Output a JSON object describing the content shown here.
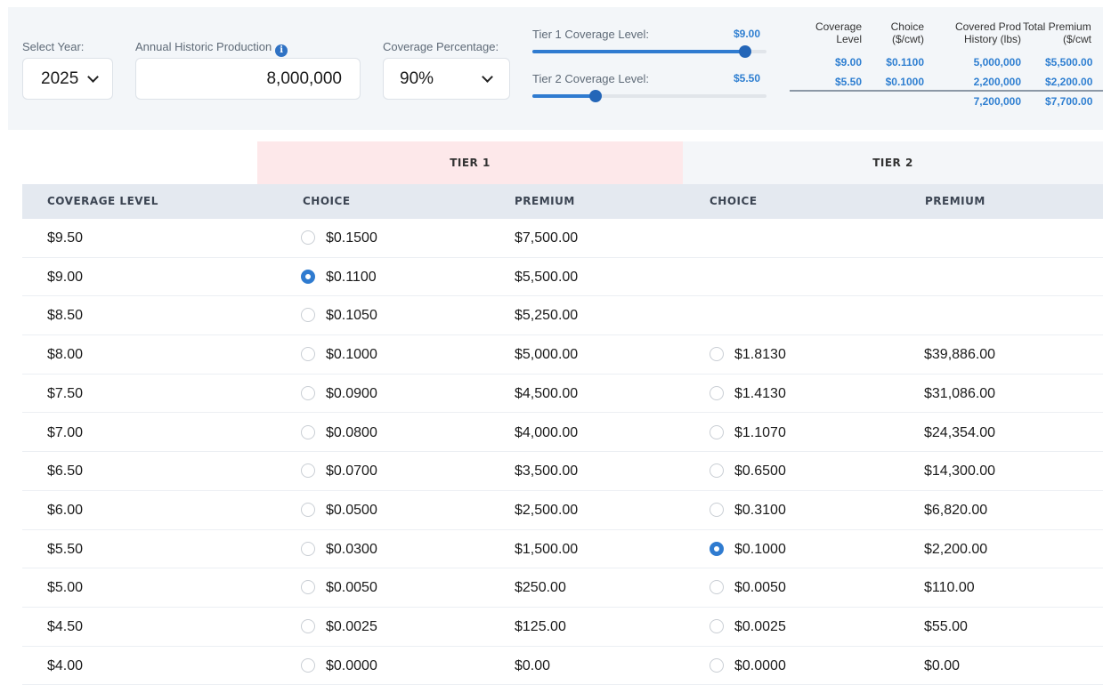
{
  "controls": {
    "year": {
      "label": "Select Year:",
      "value": "2025"
    },
    "production": {
      "label": "Annual Historic Production",
      "value": "8,000,000",
      "info_icon": "info-icon"
    },
    "coverage_pct": {
      "label": "Coverage Percentage:",
      "value": "90%"
    },
    "tier1_slider": {
      "label": "Tier 1 Coverage Level:",
      "value": "$9.00",
      "fraction": 0.91
    },
    "tier2_slider": {
      "label": "Tier 2 Coverage Level:",
      "value": "$5.50",
      "fraction": 0.27
    }
  },
  "summary": {
    "headers": [
      {
        "line1": "Coverage",
        "line2": "Level"
      },
      {
        "line1": "Choice",
        "line2": "($/cwt)"
      },
      {
        "line1": "Covered Prod",
        "line2": "History (lbs)"
      },
      {
        "line1": "Total Premium",
        "line2": "($/cwt"
      }
    ],
    "rows": [
      [
        "$9.00",
        "$0.1100",
        "5,000,000",
        "$5,500.00"
      ],
      [
        "$5.50",
        "$0.1000",
        "2,200,000",
        "$2,200.00"
      ]
    ],
    "totals": {
      "history": "7,200,000",
      "premium": "$7,700.00"
    }
  },
  "table": {
    "tier1_label": "TIER 1",
    "tier2_label": "TIER 2",
    "columns": [
      "COVERAGE LEVEL",
      "CHOICE",
      "PREMIUM",
      "CHOICE",
      "PREMIUM"
    ],
    "rows": [
      {
        "level": "$9.50",
        "t1_choice": "$0.1500",
        "t1_premium": "$7,500.00",
        "t1_selected": false,
        "t2_choice": "",
        "t2_premium": "",
        "t2_selected": false
      },
      {
        "level": "$9.00",
        "t1_choice": "$0.1100",
        "t1_premium": "$5,500.00",
        "t1_selected": true,
        "t2_choice": "",
        "t2_premium": "",
        "t2_selected": false
      },
      {
        "level": "$8.50",
        "t1_choice": "$0.1050",
        "t1_premium": "$5,250.00",
        "t1_selected": false,
        "t2_choice": "",
        "t2_premium": "",
        "t2_selected": false
      },
      {
        "level": "$8.00",
        "t1_choice": "$0.1000",
        "t1_premium": "$5,000.00",
        "t1_selected": false,
        "t2_choice": "$1.8130",
        "t2_premium": "$39,886.00",
        "t2_selected": false
      },
      {
        "level": "$7.50",
        "t1_choice": "$0.0900",
        "t1_premium": "$4,500.00",
        "t1_selected": false,
        "t2_choice": "$1.4130",
        "t2_premium": "$31,086.00",
        "t2_selected": false
      },
      {
        "level": "$7.00",
        "t1_choice": "$0.0800",
        "t1_premium": "$4,000.00",
        "t1_selected": false,
        "t2_choice": "$1.1070",
        "t2_premium": "$24,354.00",
        "t2_selected": false
      },
      {
        "level": "$6.50",
        "t1_choice": "$0.0700",
        "t1_premium": "$3,500.00",
        "t1_selected": false,
        "t2_choice": "$0.6500",
        "t2_premium": "$14,300.00",
        "t2_selected": false
      },
      {
        "level": "$6.00",
        "t1_choice": "$0.0500",
        "t1_premium": "$2,500.00",
        "t1_selected": false,
        "t2_choice": "$0.3100",
        "t2_premium": "$6,820.00",
        "t2_selected": false
      },
      {
        "level": "$5.50",
        "t1_choice": "$0.0300",
        "t1_premium": "$1,500.00",
        "t1_selected": false,
        "t2_choice": "$0.1000",
        "t2_premium": "$2,200.00",
        "t2_selected": true
      },
      {
        "level": "$5.00",
        "t1_choice": "$0.0050",
        "t1_premium": "$250.00",
        "t1_selected": false,
        "t2_choice": "$0.0050",
        "t2_premium": "$110.00",
        "t2_selected": false
      },
      {
        "level": "$4.50",
        "t1_choice": "$0.0025",
        "t1_premium": "$125.00",
        "t1_selected": false,
        "t2_choice": "$0.0025",
        "t2_premium": "$55.00",
        "t2_selected": false
      },
      {
        "level": "$4.00",
        "t1_choice": "$0.0000",
        "t1_premium": "$0.00",
        "t1_selected": false,
        "t2_choice": "$0.0000",
        "t2_premium": "$0.00",
        "t2_selected": false
      }
    ]
  },
  "colors": {
    "accent": "#2f7bd0",
    "tier1_bg": "#fde8ea",
    "tier2_bg": "#f4f6f9",
    "header_bg": "#e4e9f0"
  }
}
